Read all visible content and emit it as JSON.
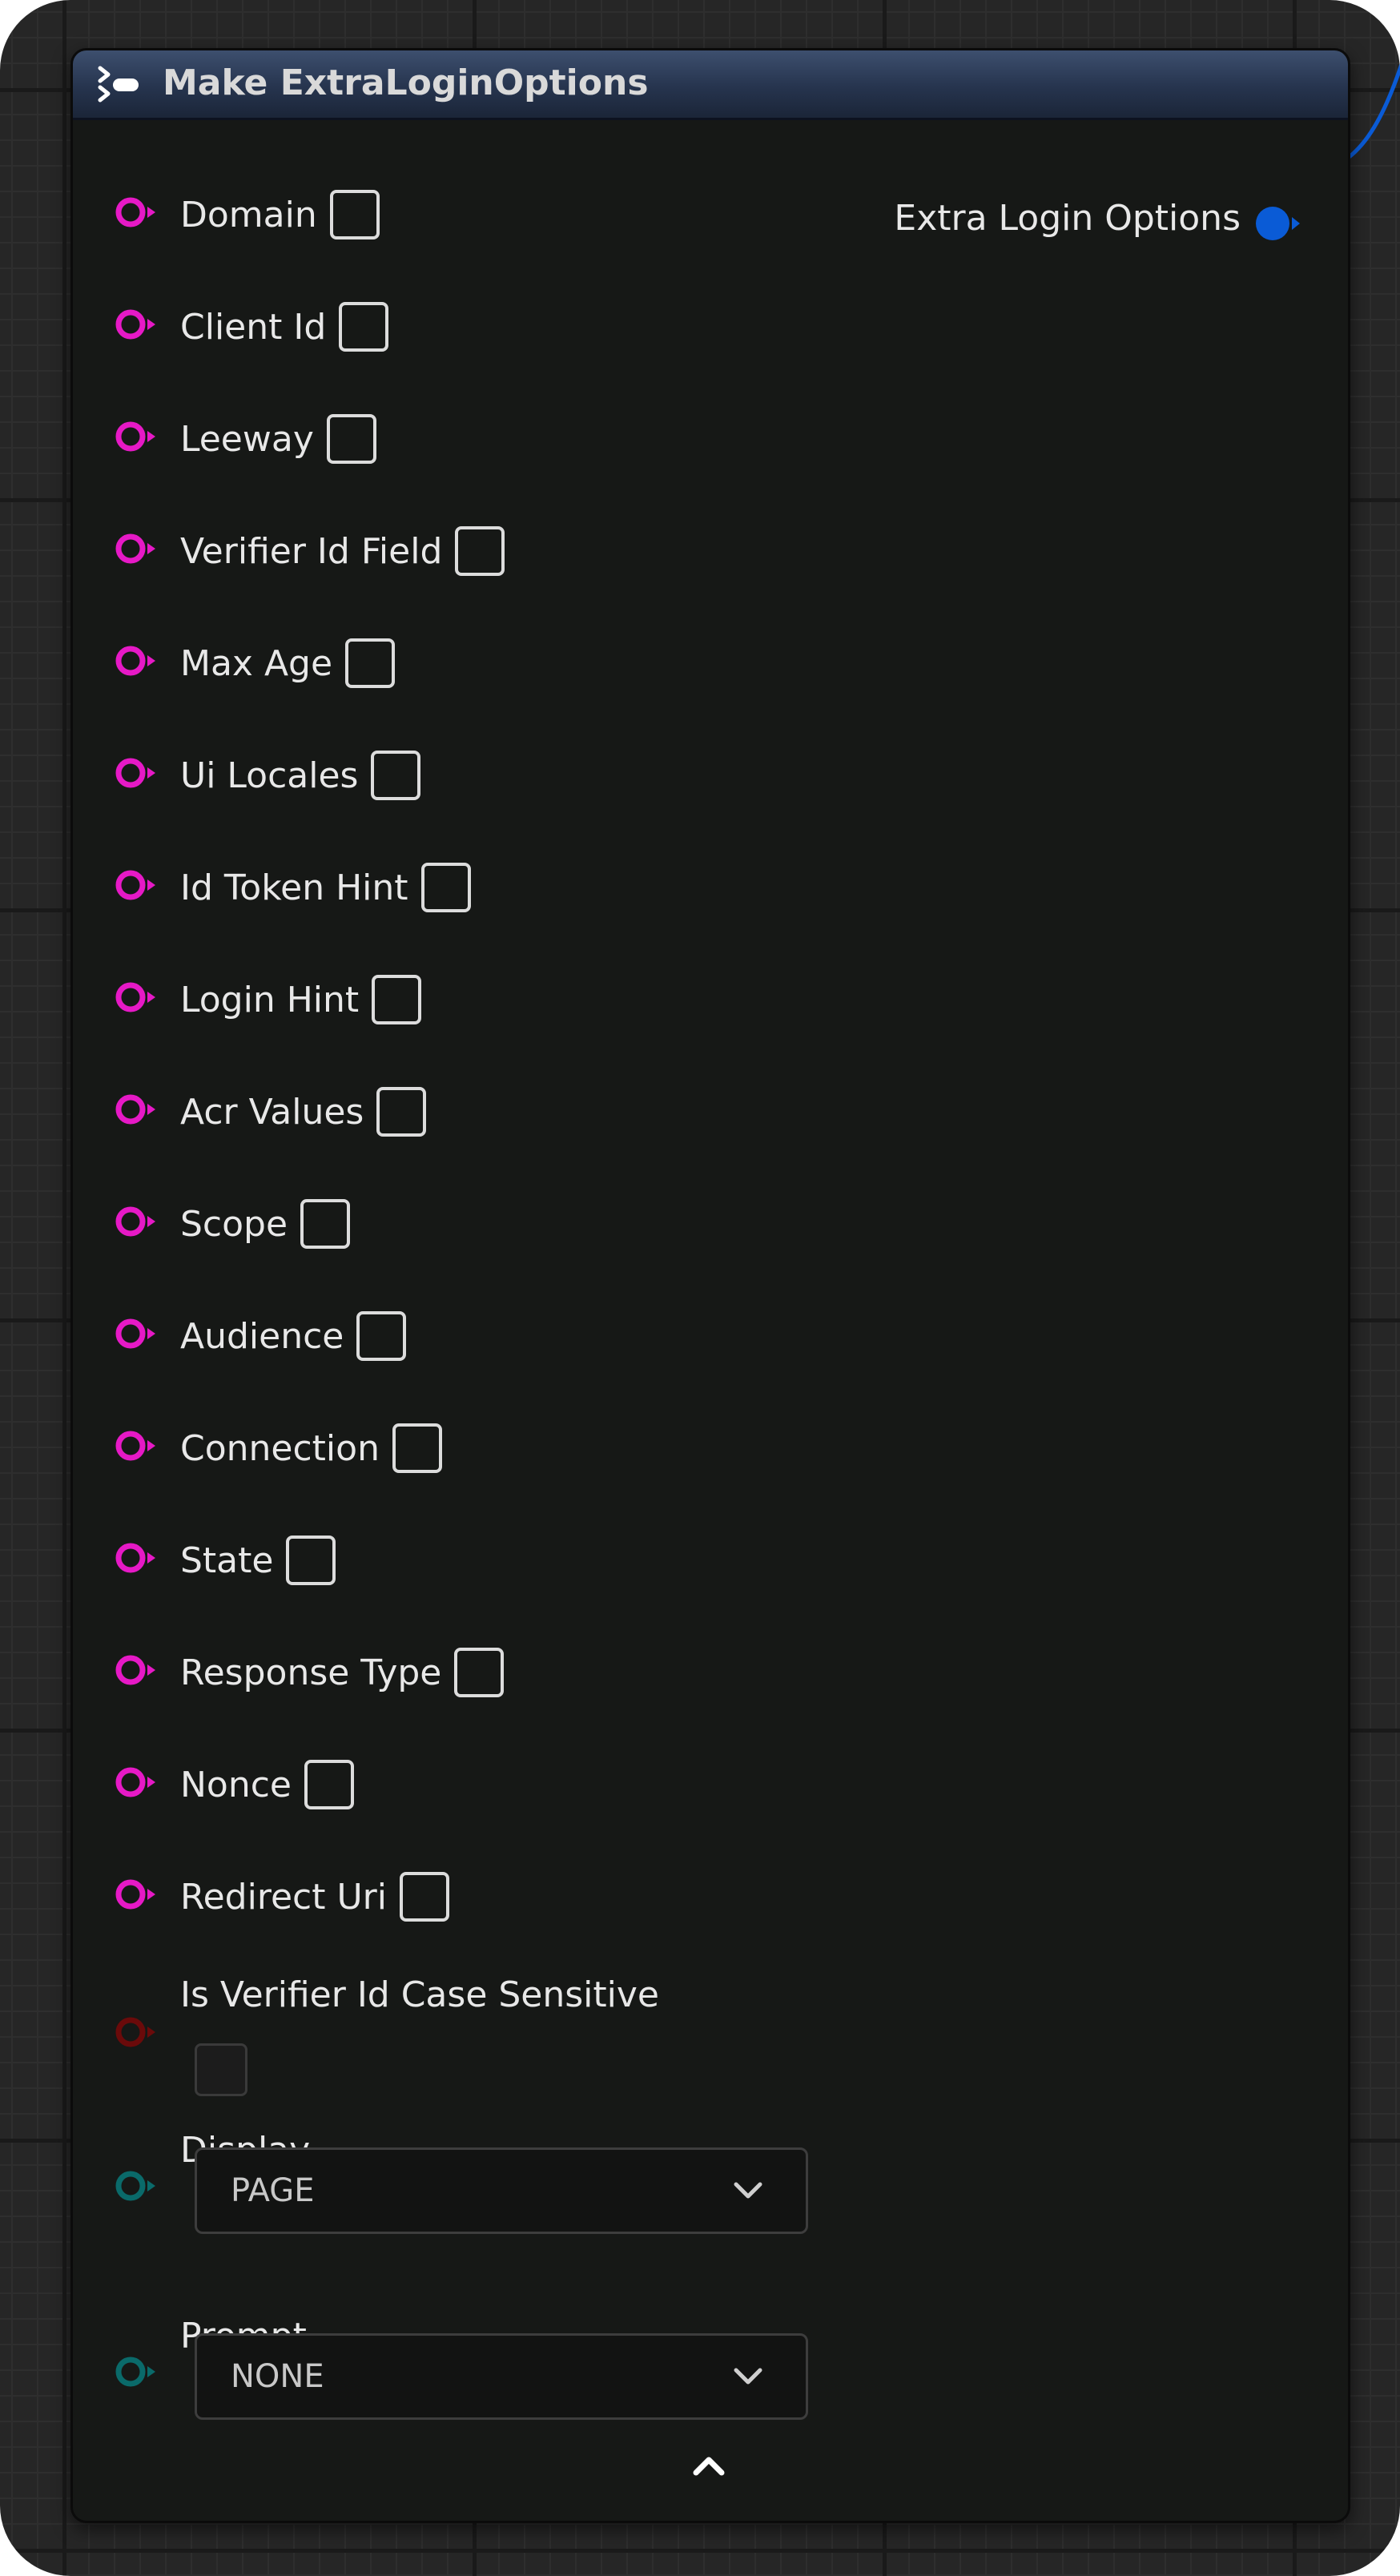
{
  "node": {
    "title": "Make ExtraLoginOptions",
    "output_label": "Extra Login Options"
  },
  "inputs": [
    {
      "label": "Domain"
    },
    {
      "label": "Client Id"
    },
    {
      "label": "Leeway"
    },
    {
      "label": "Verifier Id Field"
    },
    {
      "label": "Max Age"
    },
    {
      "label": "Ui Locales"
    },
    {
      "label": "Id Token Hint"
    },
    {
      "label": "Login Hint"
    },
    {
      "label": "Acr Values"
    },
    {
      "label": "Scope"
    },
    {
      "label": "Audience"
    },
    {
      "label": "Connection"
    },
    {
      "label": "State"
    },
    {
      "label": "Response Type"
    },
    {
      "label": "Nonce"
    },
    {
      "label": "Redirect Uri"
    }
  ],
  "bool_input": {
    "label": "Is Verifier Id Case Sensitive",
    "checked": false
  },
  "enum_inputs": [
    {
      "label": "Display",
      "value": "PAGE"
    },
    {
      "label": "Prompt",
      "value": "NONE"
    }
  ],
  "colors": {
    "string_pin": "#e619c6",
    "bool_pin": "#6a0a0a",
    "enum_pin": "#0a6a6a",
    "struct_pin": "#0a5bd6",
    "header": "#26344e",
    "node_body": "#161816",
    "grid": "#262626"
  },
  "icons": {
    "header": "make-struct-icon",
    "collapse": "chevron-up-icon",
    "dropdown": "chevron-down-icon"
  }
}
